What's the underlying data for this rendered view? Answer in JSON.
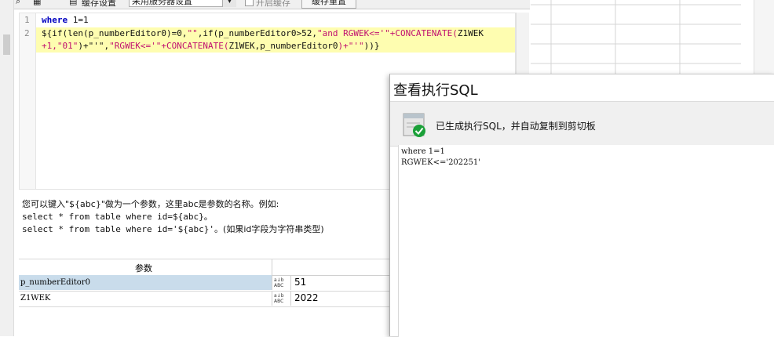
{
  "toolbar": {
    "cache_label": "缓存设置",
    "cache_select_value": "采用服务器设置",
    "enable_cache_label": "开启缓存",
    "clear_cache_label": "缓存重置"
  },
  "editor": {
    "line_numbers": [
      "1",
      "2"
    ],
    "line1_kw": "where",
    "line1_rest": " 1=1",
    "line2a_p1": "${if(",
    "line2a_p2": "len(p_numberEditor0)=0,",
    "line2a_s1": "\"\"",
    "line2a_p3": ",if(p_numberEditor0>52,",
    "line2a_s2": "\"and RGWEK<='\"+CONCATENATE(",
    "line2a_p4": "Z1WEK",
    "line2b_s1": "+1,",
    "line2b_s2": "\"01\"",
    "line2b_s3": ")+\"'\",",
    "line2b_s4": "\"RGWEK<='\"+CONCATENATE(",
    "line2b_p1": "Z1WEK,p_numberEditor0",
    "line2b_s5": ")+\"'\"",
    "line2b_p2": "))}"
  },
  "help": {
    "line1": "您可以键入\"${abc}\"做为一个参数，这里abc是参数的名称。例如:",
    "line2": "select * from table where id=${abc}。",
    "line3_code": "select * from table where id='${abc}'。",
    "line3_note": "(如果id字段为字符串类型)"
  },
  "params": {
    "header": "参数",
    "type_icon": "ABC",
    "rows": [
      {
        "name": "p_numberEditor0",
        "value": "51"
      },
      {
        "name": "Z1WEK",
        "value": "2022"
      }
    ]
  },
  "dialog": {
    "title": "查看执行SQL",
    "message": "已生成执行SQL，并自动复制到剪切板",
    "sql_line1": "where 1=1",
    "sql_line2": "RGWEK<='202251'"
  },
  "colors": {
    "keyword": "#0000c0",
    "string": "#c01070",
    "current_line": "#fefdb0",
    "selected_row": "#c9dceb",
    "success_green": "#1aa038"
  }
}
